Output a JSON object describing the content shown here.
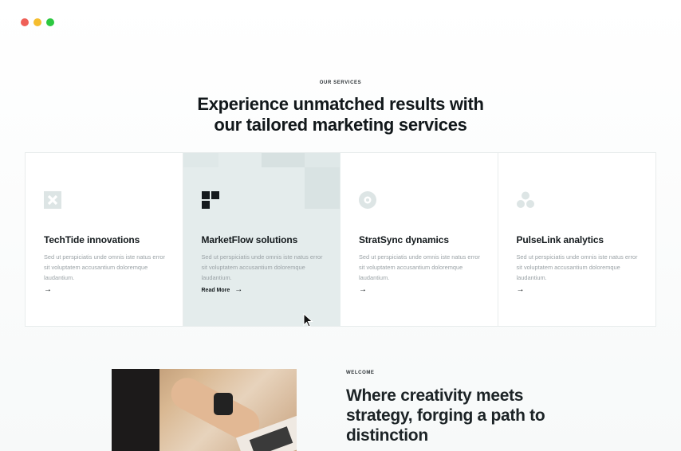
{
  "services": {
    "eyebrow": "OUR SERVICES",
    "heading_line1": "Experience unmatched results with",
    "heading_line2": "our tailored marketing services",
    "cards": [
      {
        "icon": "x-square-icon",
        "title": "TechTide innovations",
        "desc": "Sed ut perspiciatis unde omnis iste natus error sit voluptatem accusantium doloremque laudantium.",
        "action": ""
      },
      {
        "icon": "blocks-icon",
        "title": "MarketFlow solutions",
        "desc": "Sed ut perspiciatis unde omnis iste natus error sit voluptatem accusantium doloremque laudantium.",
        "action": "Read More"
      },
      {
        "icon": "target-icon",
        "title": "StratSync dynamics",
        "desc": "Sed ut perspiciatis unde omnis iste natus error sit voluptatem accusantium doloremque laudantium.",
        "action": ""
      },
      {
        "icon": "circles-icon",
        "title": "PulseLink analytics",
        "desc": "Sed ut perspiciatis unde omnis iste natus error sit voluptatem accusantium doloremque laudantium.",
        "action": ""
      }
    ]
  },
  "welcome": {
    "eyebrow": "WELCOME",
    "heading": "Where creativity meets strategy, forging a path to distinction"
  },
  "colors": {
    "active_card_bg": "#e4ecec",
    "muted_icon": "#dde5e5",
    "dark_icon": "#141a1d"
  }
}
